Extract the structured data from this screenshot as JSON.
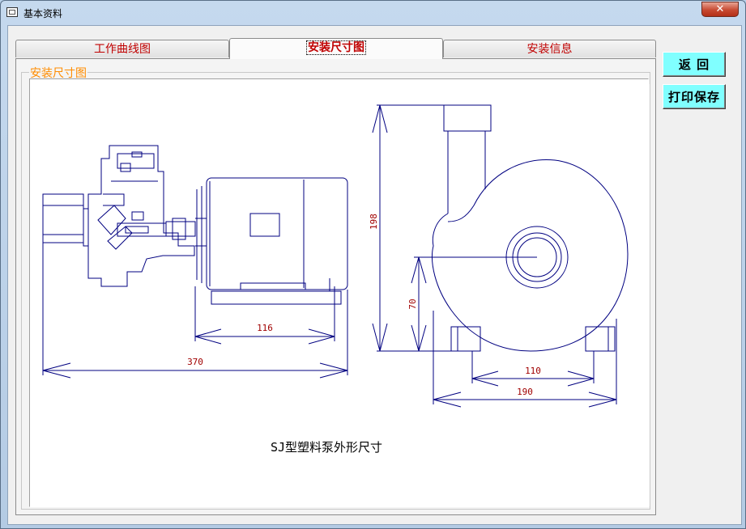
{
  "window": {
    "title": "基本资料",
    "close_label": "✕"
  },
  "tabs": [
    {
      "label": "工作曲线图",
      "active": false
    },
    {
      "label": "安装尺寸图",
      "active": true
    },
    {
      "label": "安装信息",
      "active": false
    }
  ],
  "panel": {
    "group_label": "安装尺寸图"
  },
  "drawing": {
    "caption": "SJ型塑料泵外形尺寸",
    "dimensions": {
      "motor_width": "116",
      "total_length": "370",
      "total_height": "198",
      "shaft_height": "70",
      "foot_spacing": "110",
      "base_width": "190"
    },
    "line_color": "#000080",
    "dim_color": "#000080",
    "text_color": "#a00000"
  },
  "buttons": {
    "back": "返 回",
    "print_save": "打印保存"
  }
}
